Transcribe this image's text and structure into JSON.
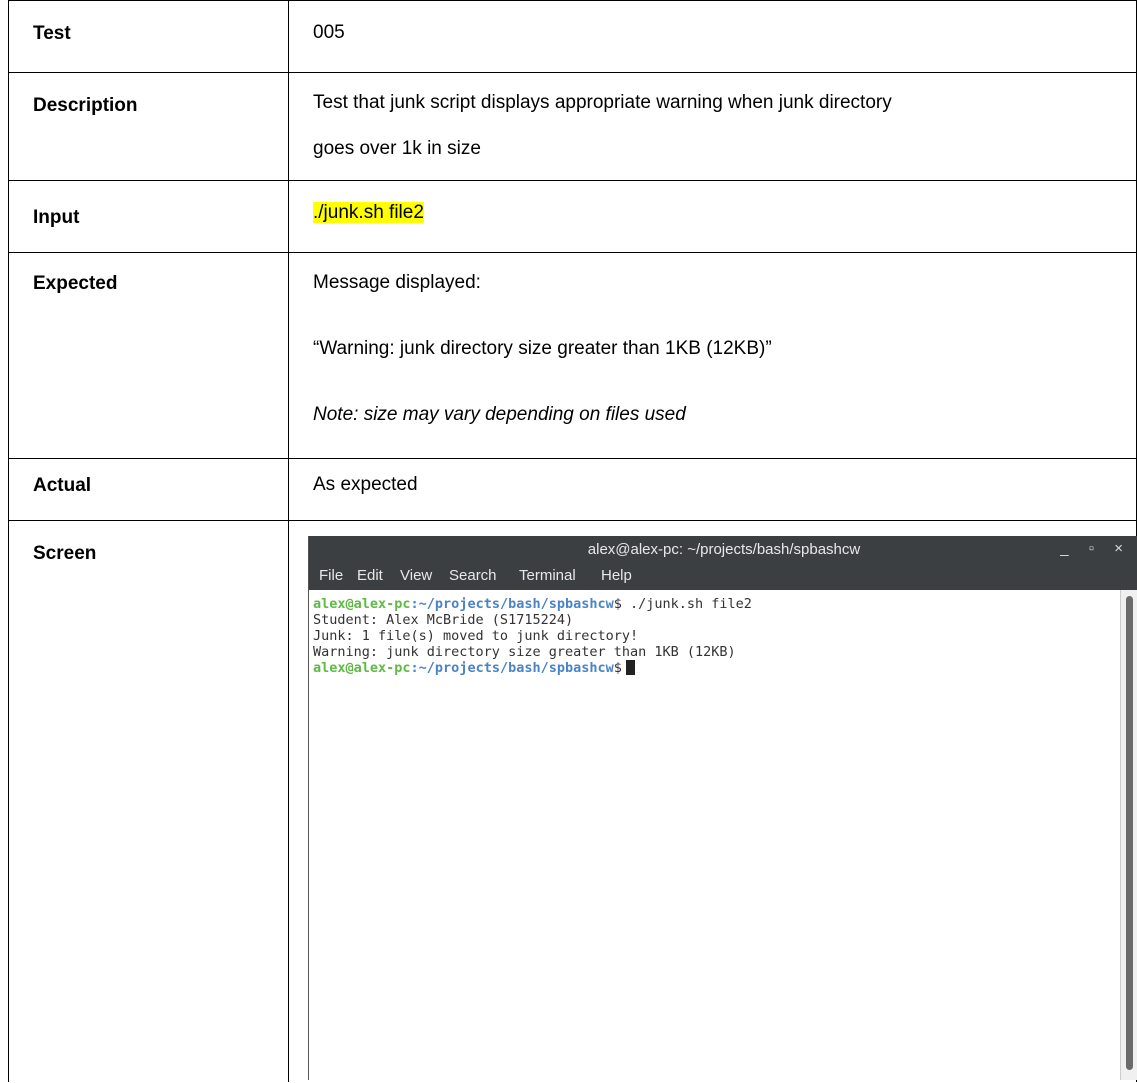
{
  "rows": [
    {
      "label": "Test",
      "value": "005"
    },
    {
      "label": "Description",
      "value_line1": "Test that junk script displays appropriate warning when junk directory",
      "value_line2": "goes over 1k in size"
    },
    {
      "label": "Input",
      "value": "./junk.sh file2"
    },
    {
      "label": "Expected",
      "line1": "Message displayed:",
      "line2": "“Warning: junk directory size greater than 1KB (12KB)”",
      "line3": "Note: size may vary depending on files used"
    },
    {
      "label": "Actual",
      "value": "As expected"
    },
    {
      "label": "Screen"
    }
  ],
  "terminal": {
    "title": "alex@alex-pc: ~/projects/bash/spbashcw",
    "window_buttons": "_ ▫ ×",
    "menu": [
      "File",
      "Edit",
      "View",
      "Search",
      "Terminal",
      "Help"
    ],
    "prompt_user": "alex@alex-pc",
    "prompt_path": ":~/projects/bash/spbashcw",
    "prompt_sign": "$",
    "command": " ./junk.sh file2",
    "output": [
      "Student: Alex McBride (S1715224)",
      "Junk: 1 file(s) moved to junk directory!",
      "Warning: junk directory size greater than 1KB (12KB)"
    ]
  }
}
